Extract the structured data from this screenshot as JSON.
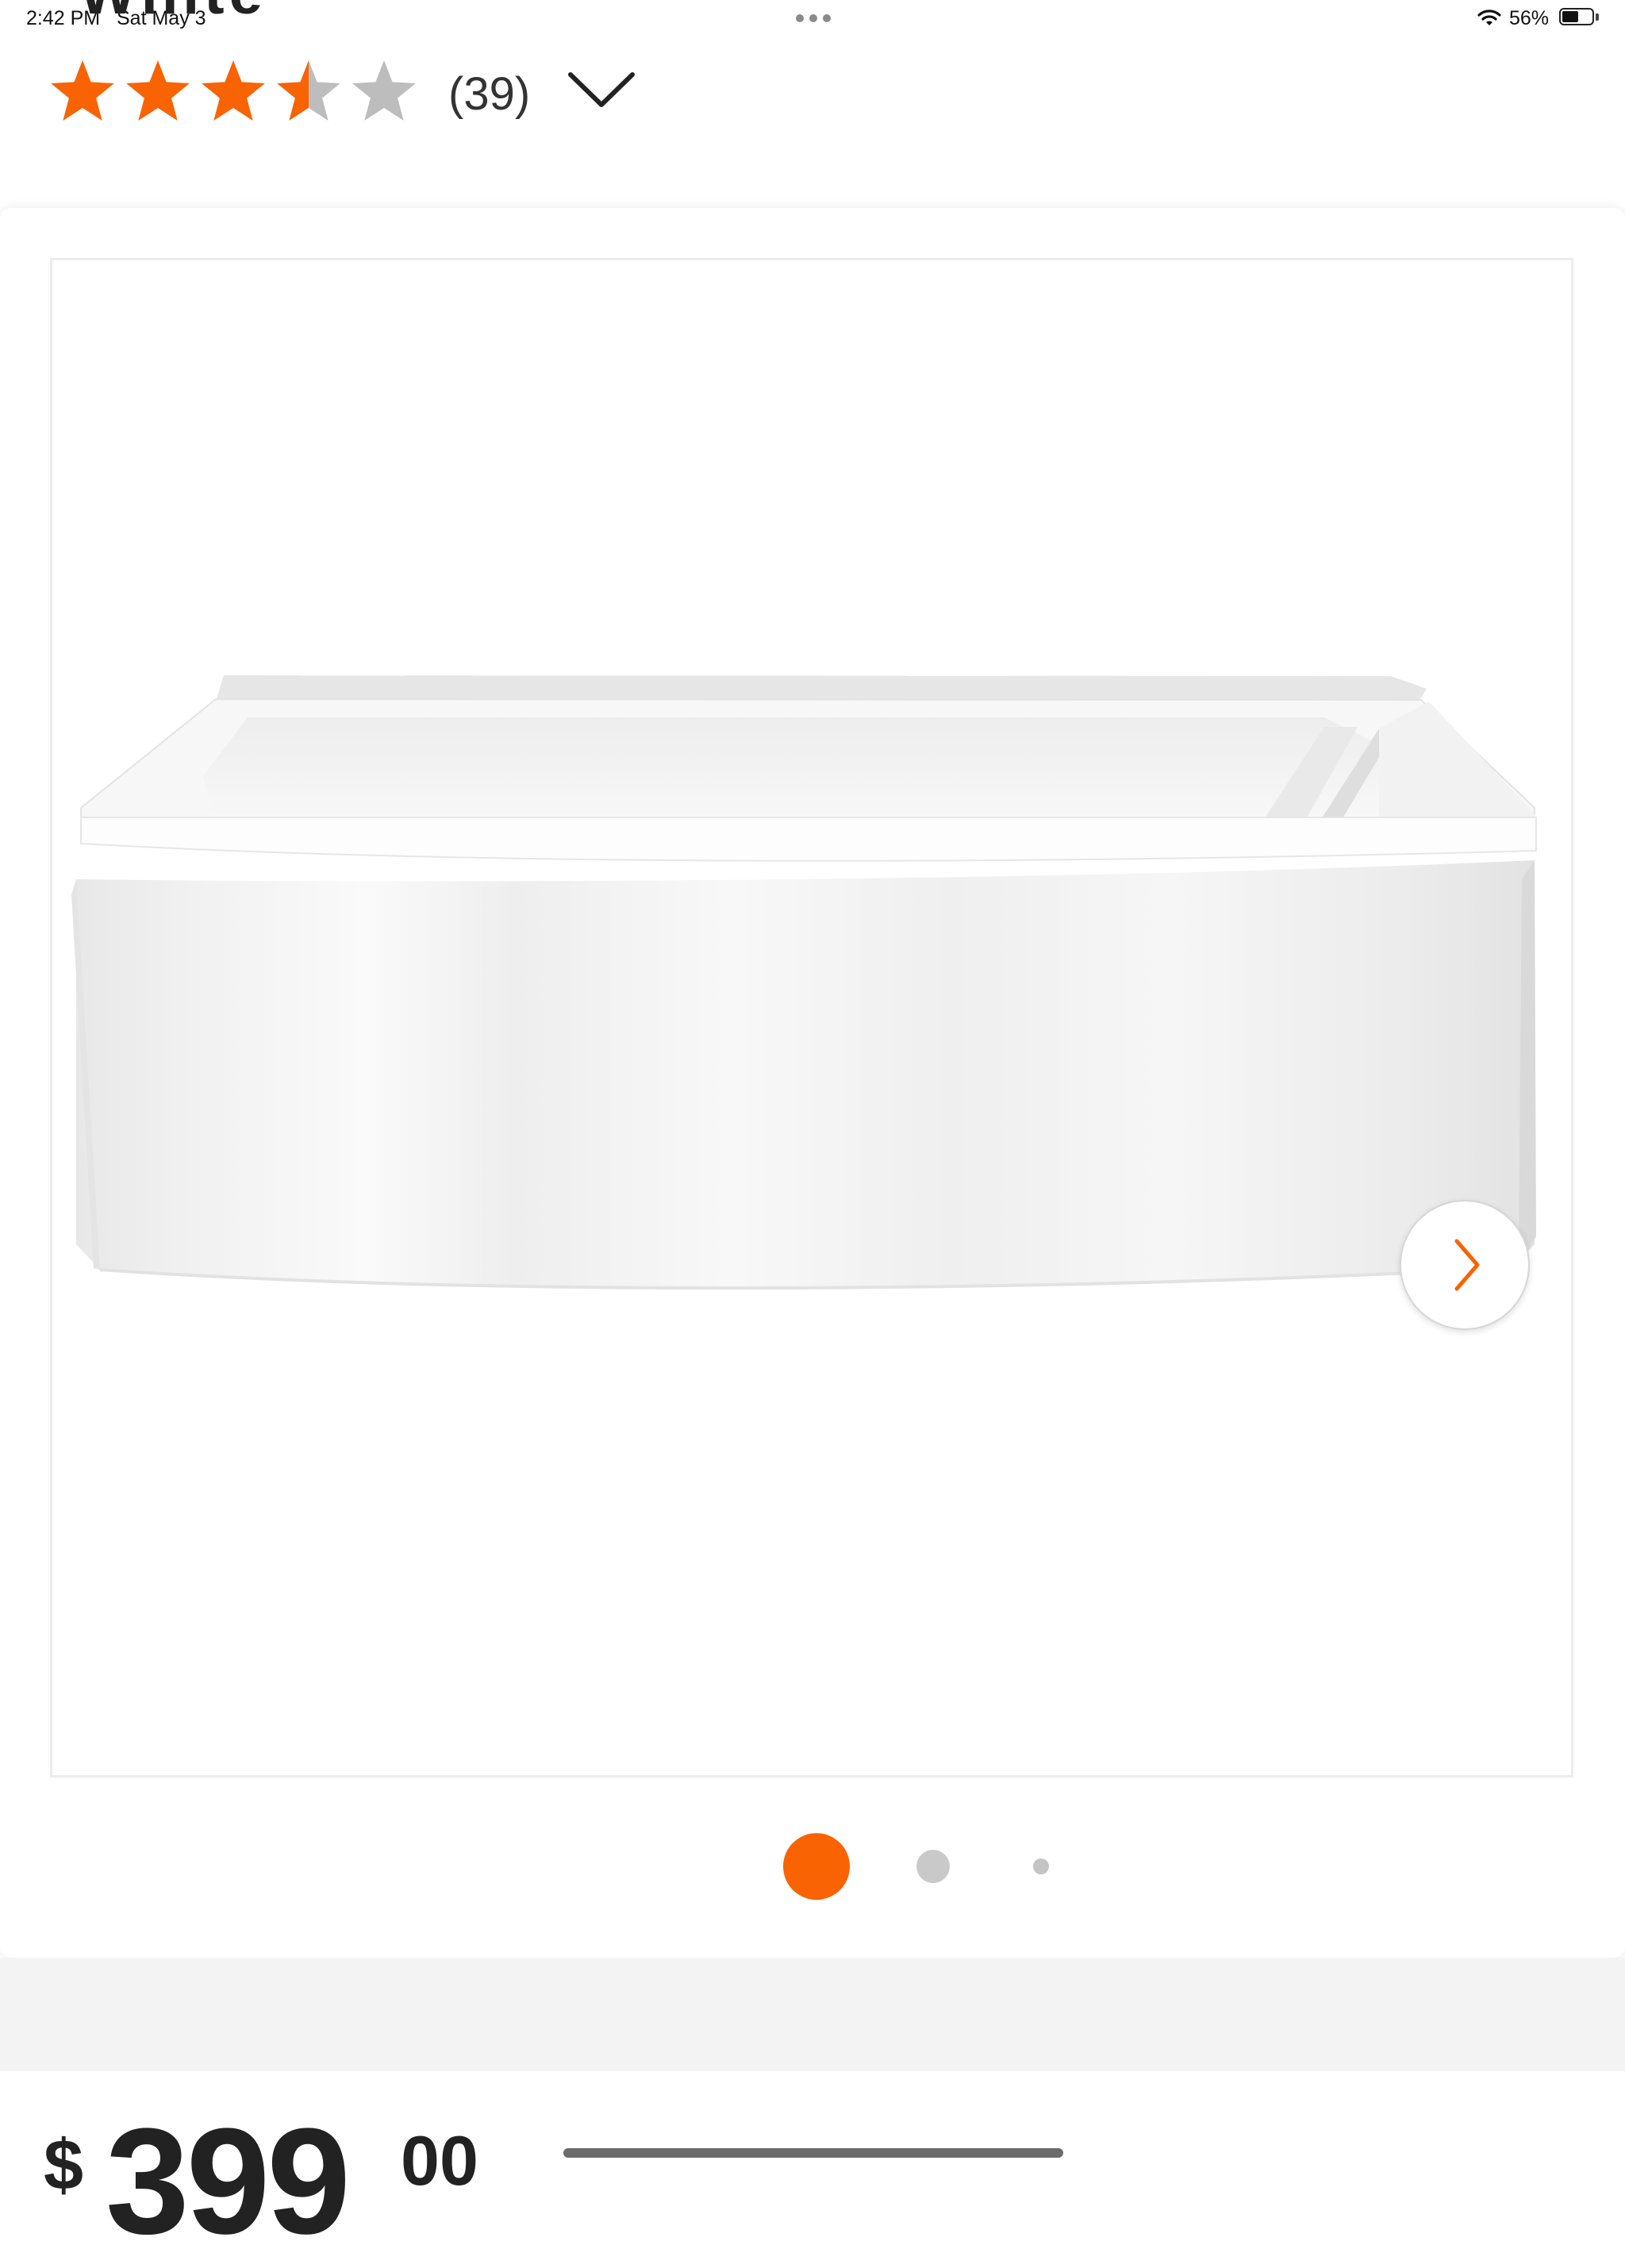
{
  "status_bar": {
    "time": "2:42 PM",
    "date": "Sat May 3",
    "battery_percent": "56%",
    "battery_level": 0.56
  },
  "product": {
    "title_fragment": "White",
    "rating": 3.5,
    "rating_max": 5,
    "review_count": "(39)",
    "price_symbol": "$",
    "price_dollars": "399",
    "price_cents": "00"
  },
  "gallery": {
    "image_alt": "bathtub",
    "slide_count": 3,
    "active_slide": 1,
    "next_icon": "chevron-right-icon"
  },
  "colors": {
    "accent": "#f96302",
    "star_empty": "#bdbdbd",
    "dot_inactive": "#c9c9c9"
  }
}
